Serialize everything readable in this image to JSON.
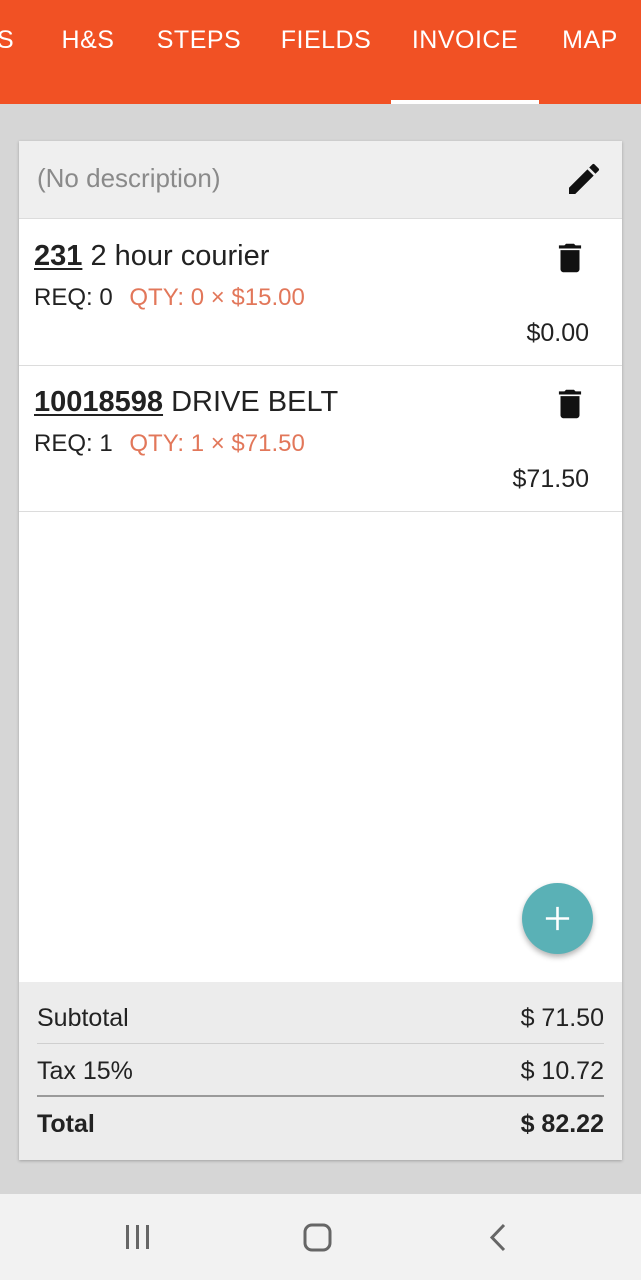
{
  "tabs": [
    {
      "label": "ES",
      "active": false
    },
    {
      "label": "H&S",
      "active": false
    },
    {
      "label": "STEPS",
      "active": false
    },
    {
      "label": "FIELDS",
      "active": false
    },
    {
      "label": "INVOICE",
      "active": true
    },
    {
      "label": "MAP",
      "active": false
    }
  ],
  "invoice": {
    "description": "(No description)",
    "items": [
      {
        "code": "231",
        "name": "2 hour courier",
        "req": "REQ: 0",
        "qty": "QTY: 0 × $15.00",
        "total": "$0.00"
      },
      {
        "code": "10018598",
        "name": "DRIVE BELT",
        "req": "REQ: 1",
        "qty": "QTY: 1 × $71.50",
        "total": "$71.50"
      }
    ],
    "subtotal_label": "Subtotal",
    "subtotal_value": "$ 71.50",
    "tax_label": "Tax 15%",
    "tax_value": "$ 10.72",
    "total_label": "Total",
    "total_value": "$ 82.22"
  },
  "colors": {
    "tabbar": "#f15124",
    "qty_text": "#e2775a",
    "fab": "#5ab1b6"
  },
  "icons": {
    "edit": "pencil-icon",
    "delete": "trash-icon",
    "add": "plus-icon",
    "nav": [
      "recent-apps-icon",
      "home-icon",
      "back-icon"
    ]
  }
}
